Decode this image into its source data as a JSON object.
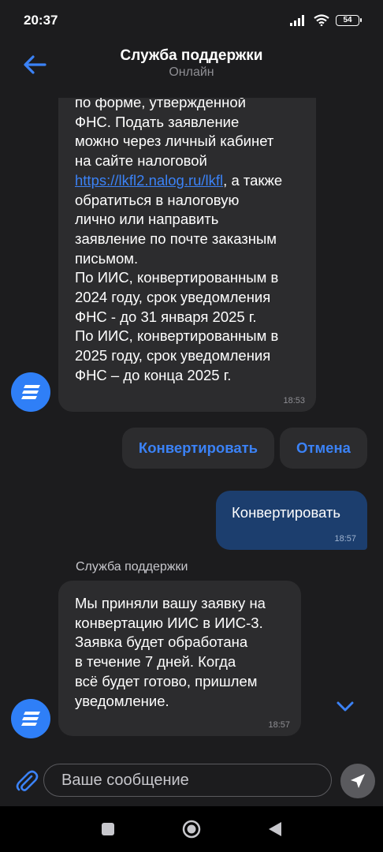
{
  "status_bar": {
    "time": "20:37",
    "battery": "54"
  },
  "header": {
    "title": "Служба поддержки",
    "subtitle": "Онлайн"
  },
  "messages": {
    "incoming_1": {
      "text_before_link": "по форме, утвержденной\nФНС. Подать заявление\nможно через личный кабинет\nна сайте налоговой ",
      "link": "https://lkfl2.nalog.ru/lkfl",
      "text_after_link": ", а также\nобратиться в налоговую\nлично или направить\nзаявление по почте заказным\nписьмом.\nПо ИИС, конвертированным в\n2024 году, срок уведомления\nФНС - до 31 января 2025 г.\nПо ИИС, конвертированным в\n2025 году, срок уведомления\nФНС – до конца 2025 г.",
      "time": "18:53"
    },
    "quick_replies": {
      "convert": "Конвертировать",
      "cancel": "Отмена"
    },
    "outgoing_1": {
      "text": "Конвертировать",
      "time": "18:57"
    },
    "incoming_2": {
      "sender": "Служба поддержки",
      "text": "Мы приняли вашу заявку на\nконвертацию ИИС в ИИС-3.\nЗаявка будет обработана\nв течение 7 дней. Когда\nвсё будет готово, пришлем\nуведомление.",
      "time": "18:57"
    }
  },
  "composer": {
    "placeholder": "Ваше сообщение"
  },
  "colors": {
    "accent": "#3b82f6",
    "avatar": "#2f7ff7",
    "outgoing_bubble": "#1c3e6e",
    "incoming_bubble": "#2c2c2e",
    "background": "#1c1c1e"
  },
  "icons": [
    "signal-icon",
    "wifi-icon",
    "battery-icon",
    "back-arrow-icon",
    "bot-avatar-icon",
    "chevron-down-icon",
    "paperclip-icon",
    "send-icon",
    "nav-square-icon",
    "nav-circle-icon",
    "nav-triangle-icon"
  ]
}
